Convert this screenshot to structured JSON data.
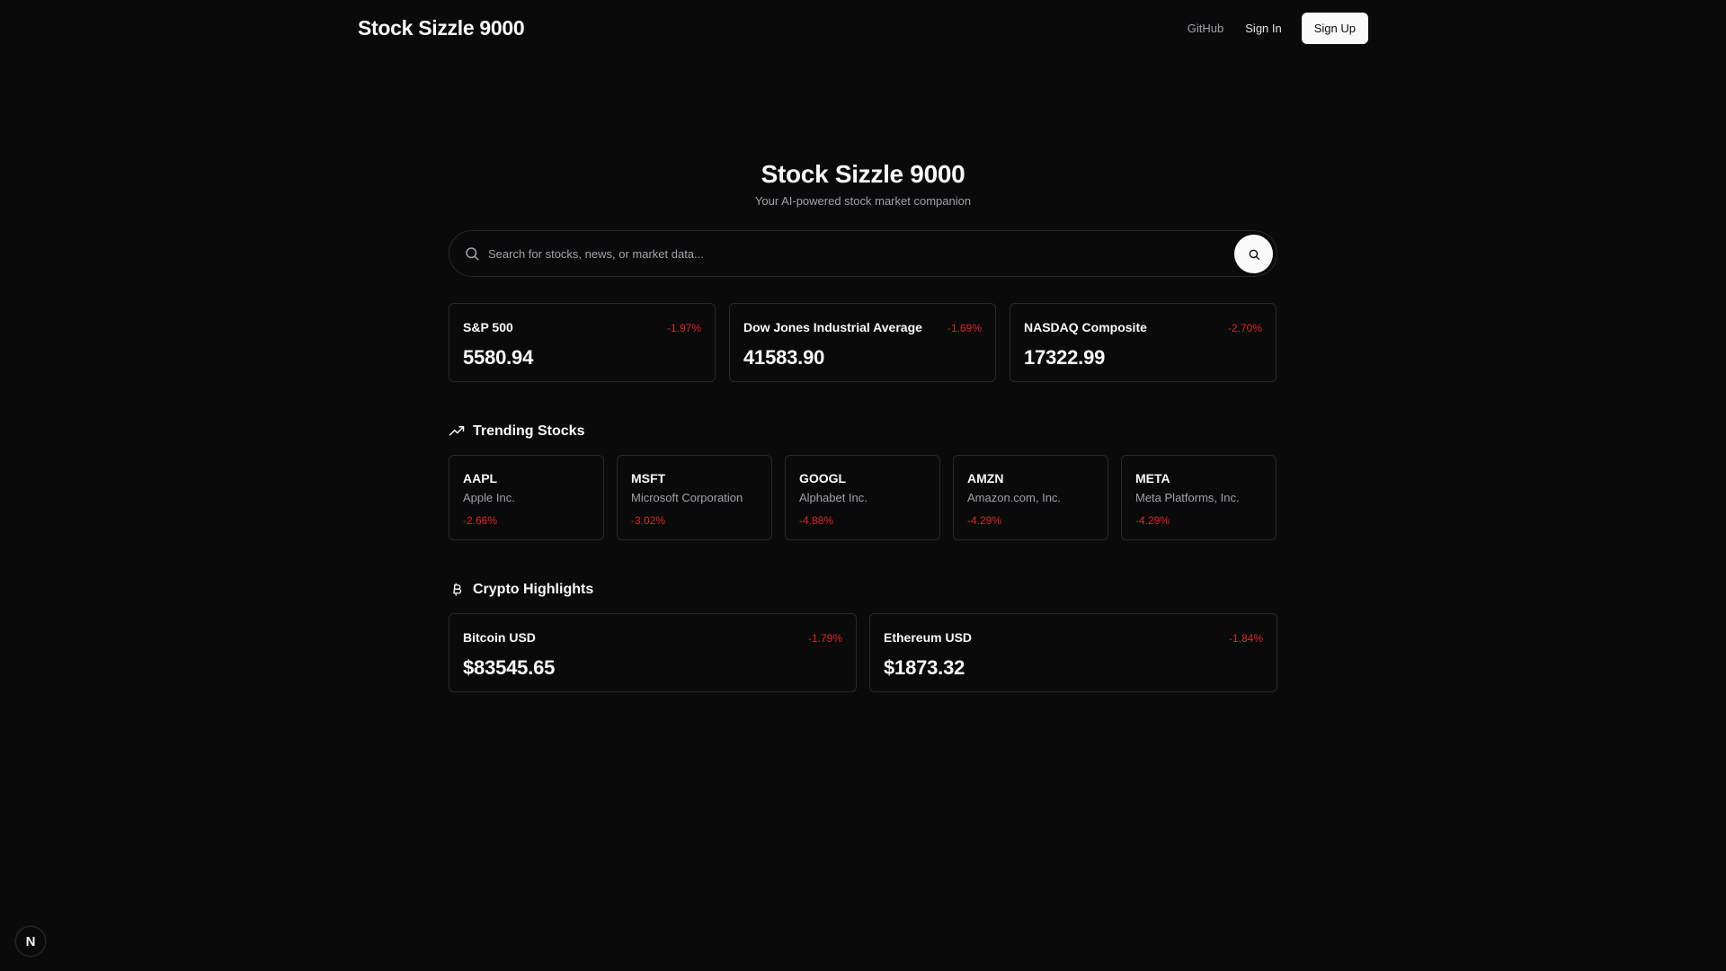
{
  "header": {
    "brand": "Stock Sizzle 9000",
    "nav": {
      "github": "GitHub",
      "signin": "Sign In",
      "signup": "Sign Up"
    }
  },
  "hero": {
    "title": "Stock Sizzle 9000",
    "subtitle": "Your AI-powered stock market companion"
  },
  "search": {
    "placeholder": "Search for stocks, news, or market data...",
    "value": ""
  },
  "indices": [
    {
      "name": "S&P 500",
      "change": "-1.97%",
      "value": "5580.94"
    },
    {
      "name": "Dow Jones Industrial Average",
      "change": "-1.69%",
      "value": "41583.90"
    },
    {
      "name": "NASDAQ Composite",
      "change": "-2.70%",
      "value": "17322.99"
    }
  ],
  "trending": {
    "title": "Trending Stocks",
    "icon": "trending-up-icon",
    "items": [
      {
        "ticker": "AAPL",
        "name": "Apple Inc.",
        "change": "-2.66%"
      },
      {
        "ticker": "MSFT",
        "name": "Microsoft Corporation",
        "change": "-3.02%"
      },
      {
        "ticker": "GOOGL",
        "name": "Alphabet Inc.",
        "change": "-4.88%"
      },
      {
        "ticker": "AMZN",
        "name": "Amazon.com, Inc.",
        "change": "-4.29%"
      },
      {
        "ticker": "META",
        "name": "Meta Platforms, Inc.",
        "change": "-4.29%"
      }
    ]
  },
  "crypto": {
    "title": "Crypto Highlights",
    "icon": "bitcoin-icon",
    "items": [
      {
        "name": "Bitcoin USD",
        "change": "-1.79%",
        "value": "$83545.65"
      },
      {
        "name": "Ethereum USD",
        "change": "-1.84%",
        "value": "$1873.32"
      }
    ]
  },
  "fab": {
    "label": "N"
  },
  "colors": {
    "background": "#0a0a0a",
    "border": "#27272a",
    "negative": "#dc2626",
    "muted_text": "#a1a1aa",
    "primary_text": "#fafafa"
  }
}
